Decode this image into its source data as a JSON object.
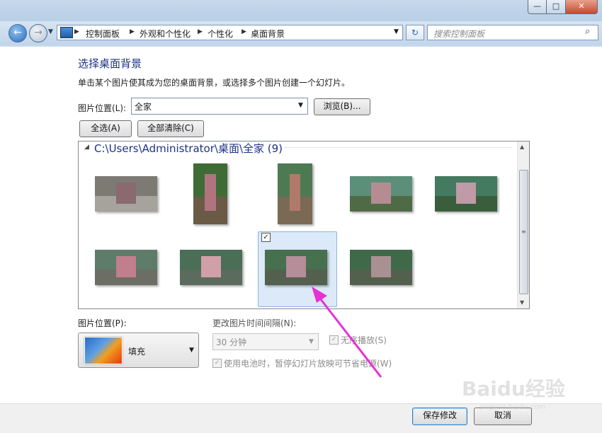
{
  "window": {
    "minimize_label": "—",
    "maximize_label": "□",
    "close_label": "✕"
  },
  "nav": {
    "breadcrumb": [
      "控制面板",
      "外观和个性化",
      "个性化",
      "桌面背景"
    ],
    "search_placeholder": "搜索控制面板"
  },
  "page": {
    "title": "选择桌面背景",
    "description": "单击某个图片使其成为您的桌面背景，或选择多个图片创建一个幻灯片。",
    "location_label": "图片位置(L):",
    "location_value": "全家",
    "browse_label": "浏览(B)...",
    "select_all_label": "全选(A)",
    "clear_all_label": "全部清除(C)"
  },
  "gallery": {
    "group_header": "C:\\Users\\Administrator\\桌面\\全家 (9)",
    "selected_index": 7,
    "checked_mark": "✓",
    "images": [
      {
        "name": "photo-1",
        "colors": [
          "#7d7a74",
          "#a6a29c",
          "#8a6a6e"
        ]
      },
      {
        "name": "photo-2",
        "colors": [
          "#3f6b35",
          "#6a5a46",
          "#b0747e"
        ]
      },
      {
        "name": "photo-3",
        "colors": [
          "#4d7a52",
          "#7a6a55",
          "#b07a6a"
        ]
      },
      {
        "name": "photo-4",
        "colors": [
          "#5c8f7a",
          "#4f6b45",
          "#b58c92"
        ]
      },
      {
        "name": "photo-5",
        "colors": [
          "#447a5f",
          "#3a5e3c",
          "#c09aa6"
        ]
      },
      {
        "name": "photo-6",
        "colors": [
          "#5e7c6a",
          "#6c6e65",
          "#c07f8a"
        ]
      },
      {
        "name": "photo-7",
        "colors": [
          "#4a6e56",
          "#5b6c5e",
          "#d0a0a8"
        ]
      },
      {
        "name": "photo-8",
        "colors": [
          "#47704f",
          "#54604e",
          "#b58e9a"
        ]
      },
      {
        "name": "photo-9",
        "colors": [
          "#3f6a4a",
          "#54604e",
          "#a99092"
        ]
      }
    ]
  },
  "options": {
    "position_label": "图片位置(P):",
    "position_value": "填充",
    "interval_label": "更改图片时间间隔(N):",
    "interval_value": "30 分钟",
    "shuffle_label": "无序播放(S)",
    "shuffle_checked": true,
    "battery_label": "使用电池时，暂停幻灯片放映可节省电源(W)",
    "battery_checked": true
  },
  "footer": {
    "save_label": "保存修改",
    "cancel_label": "取消"
  },
  "watermark": {
    "logo": "Baidu经验",
    "sub": "jingyan.baidu.com"
  },
  "colors": {
    "title_blue": "#1e3287",
    "annotation_arrow": "#e531d6",
    "selection_fill": "#dbe9f8"
  }
}
